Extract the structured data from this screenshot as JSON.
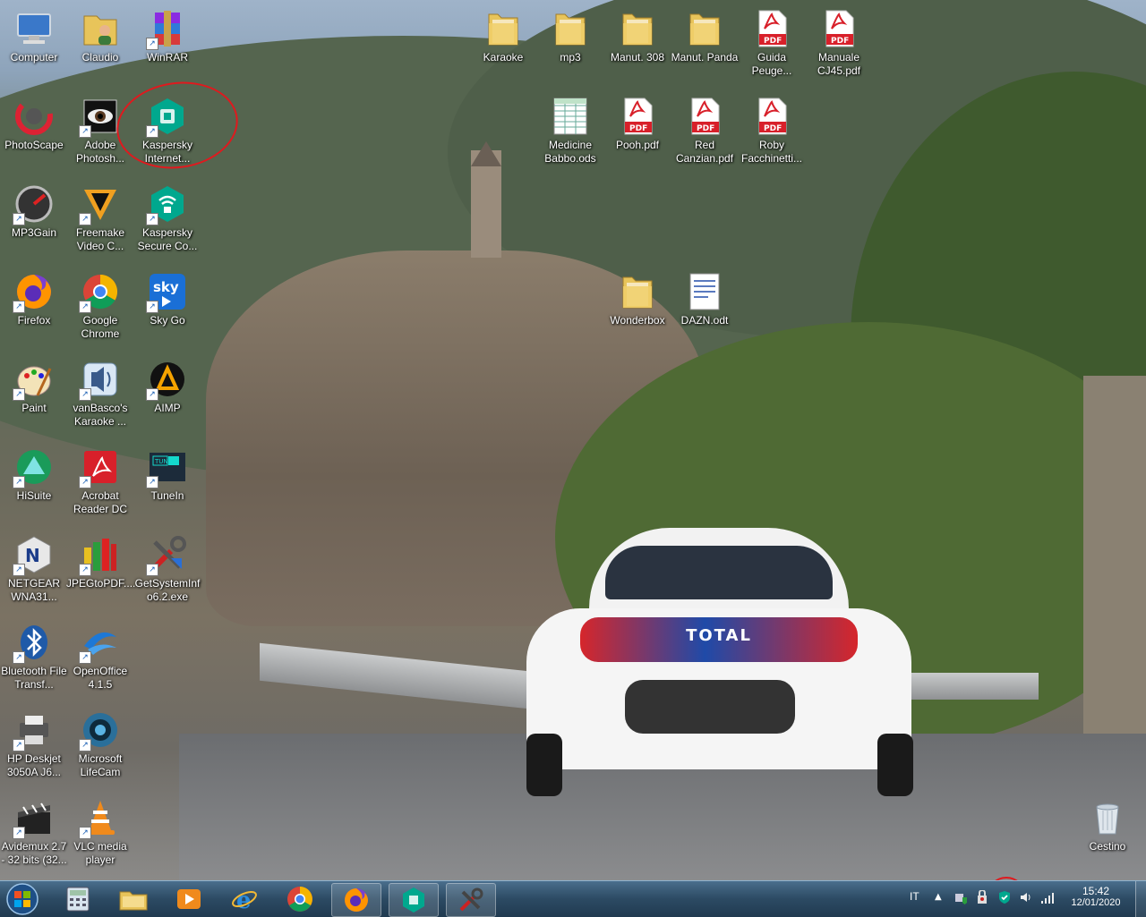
{
  "desktop": {
    "icons": [
      {
        "label": "Computer",
        "icon": "computer-icon"
      },
      {
        "label": "Claudio",
        "icon": "user-folder-icon"
      },
      {
        "label": "WinRAR",
        "icon": "winrar-icon"
      },
      {
        "label": "PhotoScape",
        "icon": "photoscape-icon"
      },
      {
        "label": "Adobe Photosh...",
        "icon": "photoshop-icon"
      },
      {
        "label": "Kaspersky Internet...",
        "icon": "kaspersky-icon"
      },
      {
        "label": "MP3Gain",
        "icon": "mp3gain-icon"
      },
      {
        "label": "Freemake Video C...",
        "icon": "freemake-icon"
      },
      {
        "label": "Kaspersky Secure Co...",
        "icon": "kaspersky-vpn-icon"
      },
      {
        "label": "Firefox",
        "icon": "firefox-icon"
      },
      {
        "label": "Google Chrome",
        "icon": "chrome-icon"
      },
      {
        "label": "Sky Go",
        "icon": "skygo-icon"
      },
      {
        "label": "Paint",
        "icon": "paint-icon"
      },
      {
        "label": "vanBasco's Karaoke ...",
        "icon": "karaoke-icon"
      },
      {
        "label": "AIMP",
        "icon": "aimp-icon"
      },
      {
        "label": "HiSuite",
        "icon": "hisuite-icon"
      },
      {
        "label": "Acrobat Reader DC",
        "icon": "acrobat-icon"
      },
      {
        "label": "TuneIn",
        "icon": "tunein-icon"
      },
      {
        "label": "NETGEAR WNA31...",
        "icon": "netgear-icon"
      },
      {
        "label": "JPEGtoPDF....",
        "icon": "jpegtopdf-icon"
      },
      {
        "label": "GetSystemInf o6.2.exe",
        "icon": "getsysteminfo-icon"
      },
      {
        "label": "Bluetooth File Transf...",
        "icon": "bluetooth-icon"
      },
      {
        "label": "OpenOffice 4.1.5",
        "icon": "openoffice-icon"
      },
      {
        "label": "HP Deskjet 3050A J6...",
        "icon": "printer-icon"
      },
      {
        "label": "Microsoft LifeCam",
        "icon": "lifecam-icon"
      },
      {
        "label": "Avidemux 2.7 - 32 bits (32...",
        "icon": "avidemux-icon"
      },
      {
        "label": "VLC media player",
        "icon": "vlc-icon"
      },
      {
        "label": "Karaoke",
        "icon": "folder-icon"
      },
      {
        "label": "mp3",
        "icon": "folder-icon"
      },
      {
        "label": "Manut. 308",
        "icon": "folder-icon"
      },
      {
        "label": "Manut. Panda",
        "icon": "folder-icon"
      },
      {
        "label": "Guida Peuge...",
        "icon": "pdf-icon"
      },
      {
        "label": "Manuale CJ45.pdf",
        "icon": "pdf-icon"
      },
      {
        "label": "Medicine Babbo.ods",
        "icon": "spreadsheet-icon"
      },
      {
        "label": "Pooh.pdf",
        "icon": "pdf-icon"
      },
      {
        "label": "Red Canzian.pdf",
        "icon": "pdf-icon"
      },
      {
        "label": "Roby Facchinetti...",
        "icon": "pdf-icon"
      },
      {
        "label": "Wonderbox",
        "icon": "folder-icon"
      },
      {
        "label": "DAZN.odt",
        "icon": "document-icon"
      },
      {
        "label": "Cestino",
        "icon": "recycle-bin-icon"
      }
    ],
    "pdf_badge": "PDF"
  },
  "taskbar": {
    "buttons": [
      {
        "name": "start",
        "icon": "windows-start-icon"
      },
      {
        "name": "calculator",
        "icon": "calculator-icon"
      },
      {
        "name": "explorer",
        "icon": "file-explorer-icon"
      },
      {
        "name": "media-player",
        "icon": "media-player-icon"
      },
      {
        "name": "internet-explorer",
        "icon": "internet-explorer-icon"
      },
      {
        "name": "chrome",
        "icon": "chrome-icon"
      },
      {
        "name": "firefox",
        "icon": "firefox-icon"
      },
      {
        "name": "kaspersky",
        "icon": "kaspersky-icon"
      },
      {
        "name": "getsysteminfo",
        "icon": "getsysteminfo-icon"
      }
    ],
    "tray": {
      "language": "IT",
      "time": "15:42",
      "date": "12/01/2020"
    }
  },
  "colors": {
    "annotation": "#e0191e",
    "folder": "#e8c45a",
    "pdf_red": "#d8202a",
    "kaspersky": "#00a88e"
  }
}
